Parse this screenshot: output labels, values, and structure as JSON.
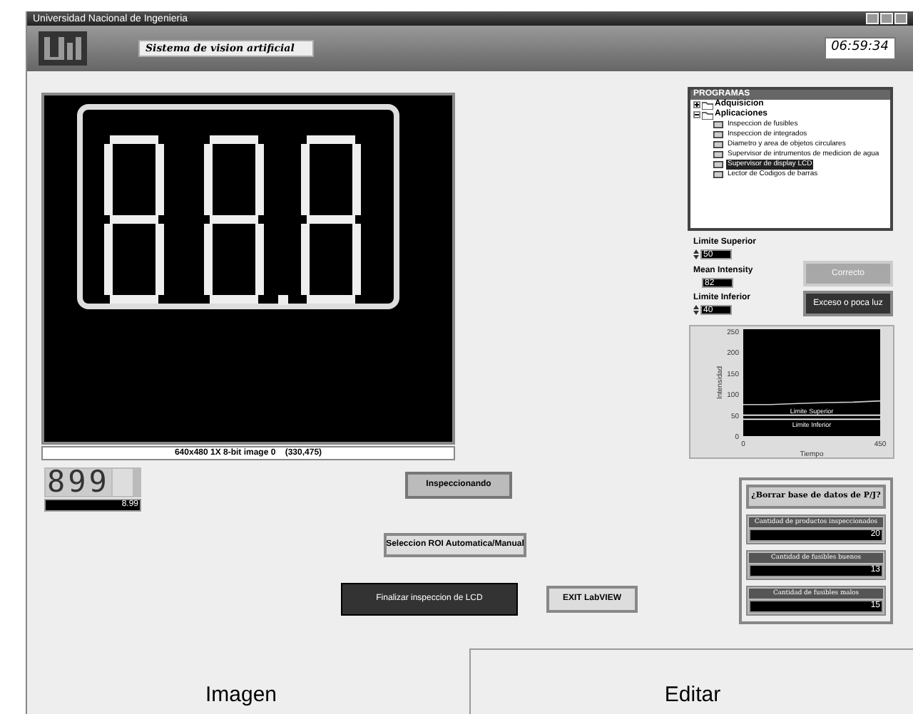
{
  "window": {
    "title": "Universidad Nacional de Ingenieria"
  },
  "header": {
    "subtitle": "Sistema de vision artificial",
    "clock": "06:59:34"
  },
  "image_display": {
    "status": "640x480 1X 8-bit image 0    (330,475)"
  },
  "digit_display": {
    "digits": "899",
    "value": "8.99"
  },
  "buttons": [
    {
      "label": "Inspeccionando",
      "kind": "status"
    },
    {
      "label": "Seleccion ROI Automatica/Manual",
      "kind": "light"
    },
    {
      "label": "Finalizar inspeccion de LCD",
      "kind": "dark"
    },
    {
      "label": "EXIT LabVIEW",
      "kind": "light"
    }
  ],
  "tree": {
    "title": "PROGRAMAS",
    "items": [
      {
        "label": "Adquisicion",
        "expanded": false
      },
      {
        "label": "Aplicaciones",
        "expanded": true,
        "children": [
          {
            "label": "Inspeccion de fusibles",
            "selected": false
          },
          {
            "label": "Inspeccion de integrados",
            "selected": false
          },
          {
            "label": "Diametro y area de objetos circulares",
            "selected": false
          },
          {
            "label": "Supervisor de intrumentos de medicion de agua",
            "selected": false
          },
          {
            "label": "Supervisor de display LCD",
            "selected": true
          },
          {
            "label": "Lector de Codigos de barras",
            "selected": false
          }
        ]
      }
    ]
  },
  "limits": [
    {
      "label": "Limite Superior",
      "value": "50",
      "kind": "control"
    },
    {
      "label": "Mean Intensity",
      "value": "82",
      "kind": "indicator"
    },
    {
      "label": "Limite Inferior",
      "value": "40",
      "kind": "control"
    }
  ],
  "status_buttons": [
    {
      "label": "Correcto",
      "disabled": true
    },
    {
      "label": "Exceso o poca luz",
      "disabled": false
    }
  ],
  "chart": {
    "chart_data": {
      "type": "line",
      "xlabel": "Tiempo",
      "ylabel": "Intensidad",
      "x": [
        0,
        90,
        180,
        270,
        360,
        450
      ],
      "xlim": [
        0,
        450
      ],
      "ylim": [
        0,
        255
      ],
      "xticks": [
        0,
        450
      ],
      "yticks": [
        0,
        50,
        100,
        150,
        200,
        250
      ],
      "series": [
        {
          "color": "#cccccc",
          "values": [
            75,
            75,
            78,
            80,
            81,
            84
          ]
        },
        {
          "name": "Limite Superior",
          "color": "#ffffff",
          "values": [
            50,
            50,
            50,
            50,
            50,
            50
          ]
        },
        {
          "name": "Limite Inferior",
          "color": "#ffffff",
          "values": [
            40,
            40,
            40,
            40,
            40,
            40
          ]
        }
      ]
    }
  },
  "database": {
    "button": "¿Borrar base de datos de P/J?",
    "counters": [
      {
        "label": "Cantidad de productos inspeccionados",
        "value": "20"
      },
      {
        "label": "Cantidad de fusibles buenos",
        "value": "13"
      },
      {
        "label": "Cantidad de fusibles malos",
        "value": "15"
      }
    ]
  },
  "tabs": [
    {
      "label": "Imagen",
      "selected": false
    },
    {
      "label": "Editar",
      "selected": true
    }
  ]
}
